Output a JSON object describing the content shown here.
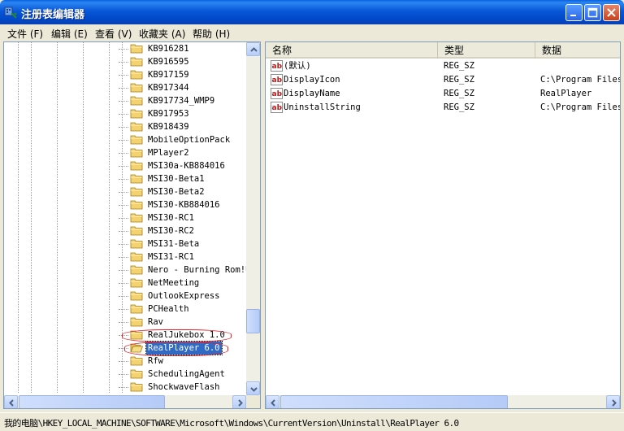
{
  "window": {
    "title": "注册表编辑器"
  },
  "menu": [
    {
      "label": "文件 (F)"
    },
    {
      "label": "编辑 (E)"
    },
    {
      "label": "查看 (V)"
    },
    {
      "label": "收藏夹 (A)"
    },
    {
      "label": "帮助 (H)"
    }
  ],
  "tree": {
    "items": [
      {
        "label": "KB916281"
      },
      {
        "label": "KB916595"
      },
      {
        "label": "KB917159"
      },
      {
        "label": "KB917344"
      },
      {
        "label": "KB917734_WMP9"
      },
      {
        "label": "KB917953"
      },
      {
        "label": "KB918439"
      },
      {
        "label": "MobileOptionPack"
      },
      {
        "label": "MPlayer2"
      },
      {
        "label": "MSI30a-KB884016"
      },
      {
        "label": "MSI30-Beta1"
      },
      {
        "label": "MSI30-Beta2"
      },
      {
        "label": "MSI30-KB884016"
      },
      {
        "label": "MSI30-RC1"
      },
      {
        "label": "MSI30-RC2"
      },
      {
        "label": "MSI31-Beta"
      },
      {
        "label": "MSI31-RC1"
      },
      {
        "label": "Nero - Burning Rom!U"
      },
      {
        "label": "NetMeeting"
      },
      {
        "label": "OutlookExpress"
      },
      {
        "label": "PCHealth"
      },
      {
        "label": "Rav"
      },
      {
        "label": "RealJukebox 1.0"
      },
      {
        "label": "RealPlayer 6.0",
        "selected": true
      },
      {
        "label": "Rfw"
      },
      {
        "label": "SchedulingAgent"
      },
      {
        "label": "ShockwaveFlash"
      }
    ]
  },
  "list": {
    "columns": [
      {
        "label": "名称"
      },
      {
        "label": "类型"
      },
      {
        "label": "数据"
      }
    ],
    "rows": [
      {
        "name": "(默认)",
        "type": "REG_SZ",
        "data": ""
      },
      {
        "name": "DisplayIcon",
        "type": "REG_SZ",
        "data": "C:\\Program Files"
      },
      {
        "name": "DisplayName",
        "type": "REG_SZ",
        "data": "RealPlayer"
      },
      {
        "name": "UninstallString",
        "type": "REG_SZ",
        "data": "C:\\Program Files"
      }
    ],
    "value_icon_text": "ab"
  },
  "status": {
    "path": "我的电脑\\HKEY_LOCAL_MACHINE\\SOFTWARE\\Microsoft\\Windows\\CurrentVersion\\Uninstall\\RealPlayer 6.0"
  },
  "colors": {
    "titlebar": "#0857d8",
    "selection": "#316ac5",
    "annotation": "#e0202a"
  }
}
